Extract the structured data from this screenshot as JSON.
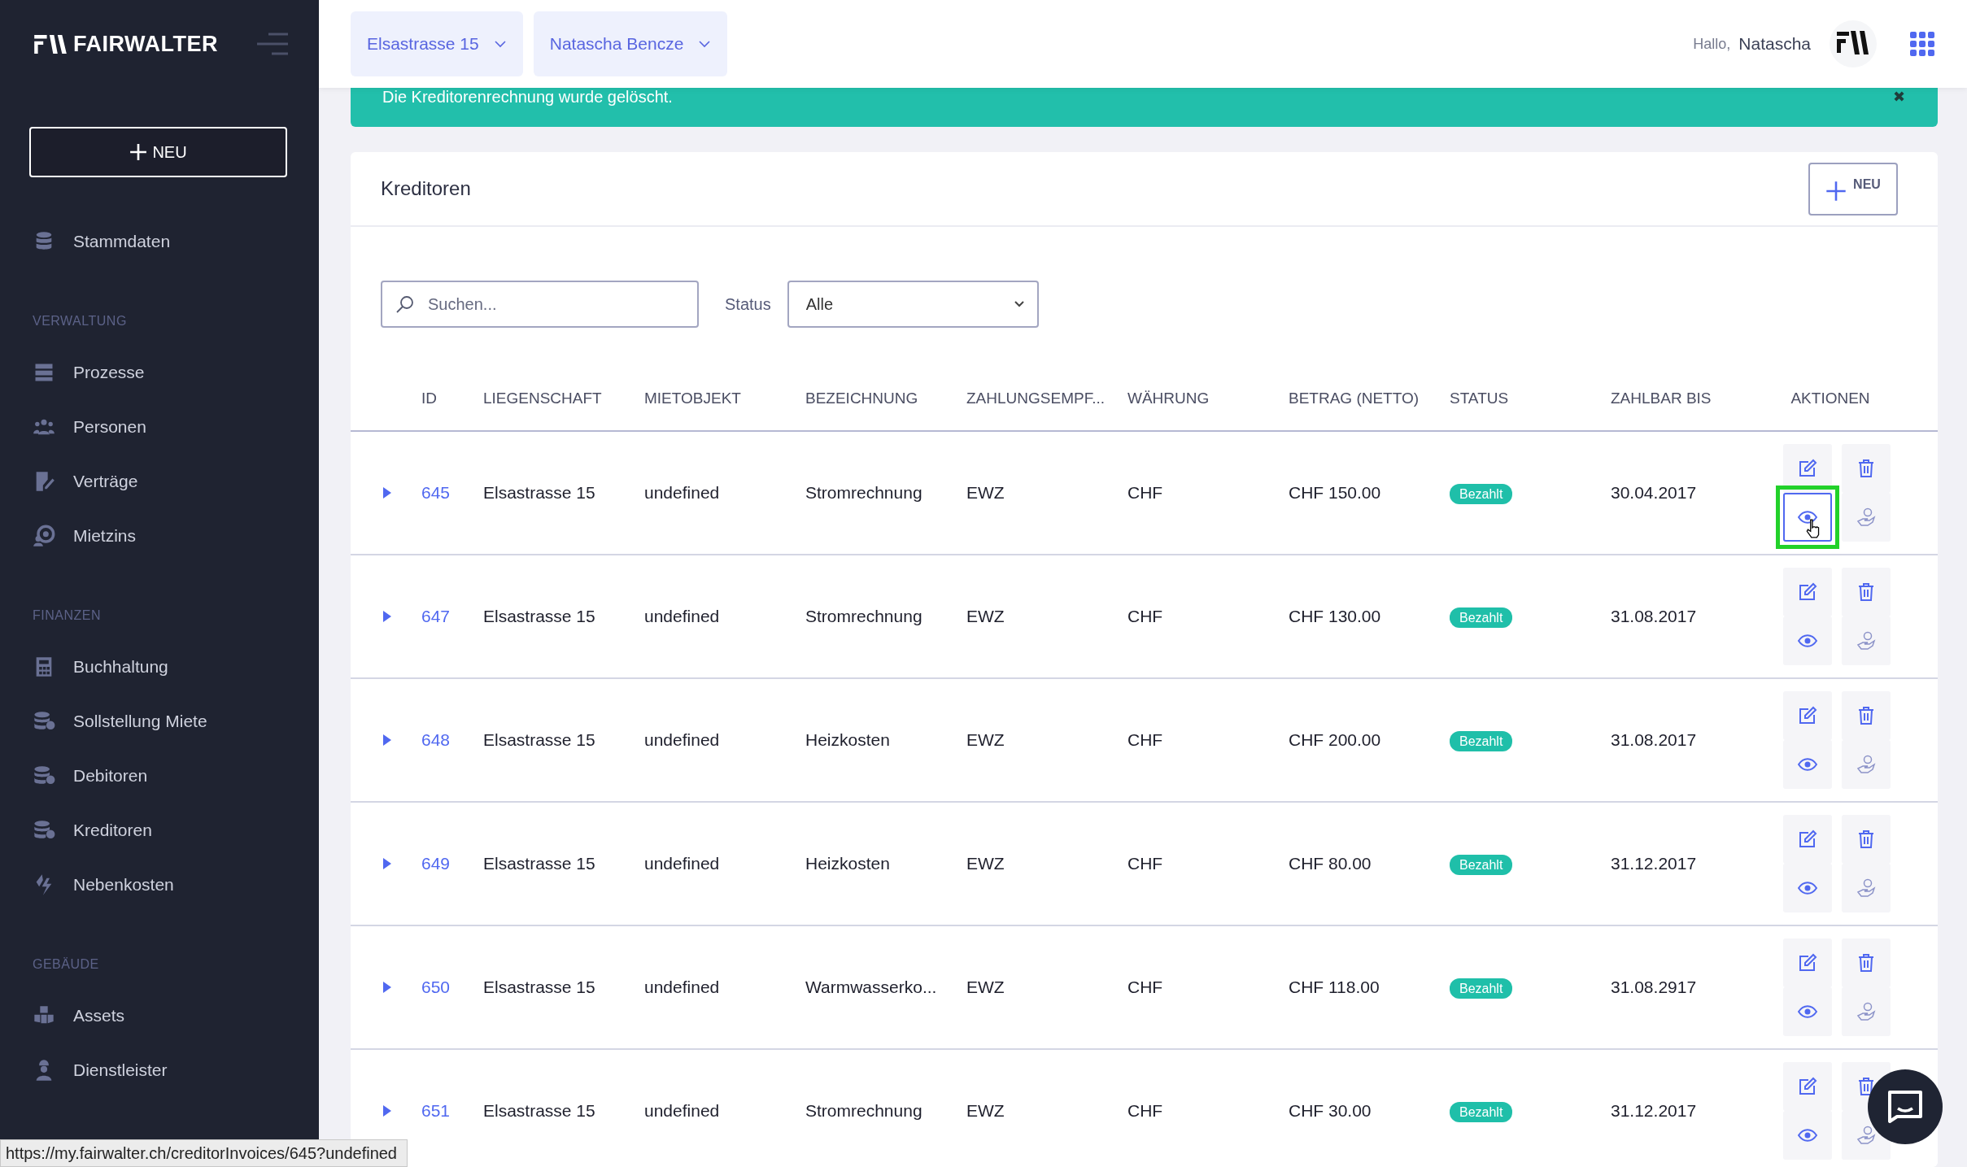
{
  "sidebar": {
    "logo": "FAIRWALTER",
    "new_button": "NEU",
    "top_items": [
      {
        "label": "Stammdaten",
        "selected": false
      }
    ],
    "sections": [
      {
        "title": "VERWALTUNG",
        "items": [
          {
            "label": "Prozesse",
            "selected": false
          },
          {
            "label": "Personen",
            "selected": false
          },
          {
            "label": "Verträge",
            "selected": false
          },
          {
            "label": "Mietzins",
            "selected": false
          }
        ]
      },
      {
        "title": "FINANZEN",
        "items": [
          {
            "label": "Buchhaltung",
            "selected": false
          },
          {
            "label": "Sollstellung Miete",
            "selected": false
          },
          {
            "label": "Debitoren",
            "selected": false
          },
          {
            "label": "Kreditoren",
            "selected": false
          },
          {
            "label": "Nebenkosten",
            "selected": false
          }
        ]
      },
      {
        "title": "GEBÄUDE",
        "items": [
          {
            "label": "Assets",
            "selected": false
          },
          {
            "label": "Dienstleister",
            "selected": false
          }
        ]
      }
    ]
  },
  "header": {
    "selectors": [
      "Elsastrasse 15",
      "Natascha Bencze"
    ],
    "greeting": "Hallo,",
    "user": "Natascha"
  },
  "notification": {
    "message": "Die Kreditorenrechnung wurde gelöscht.",
    "close": "✖"
  },
  "card": {
    "title": "Kreditoren",
    "new_button": "NEU",
    "search": {
      "placeholder": "Suchen..."
    },
    "status_label": "Status",
    "status_value": "Alle"
  },
  "table": {
    "columns": [
      "ID",
      "LIEGENSCHAFT",
      "MIETOBJEKT",
      "BEZEICHNUNG",
      "ZAHLUNGSEMPF...",
      "WÄHRUNG",
      "BETRAG (NETTO)",
      "STATUS",
      "ZAHLBAR BIS",
      "AKTIONEN"
    ],
    "rows": [
      {
        "id": "645",
        "property": "Elsastrasse 15",
        "unit": "undefined",
        "description": "Stromrechnung",
        "payee": "EWZ",
        "currency": "CHF",
        "amount": "CHF 150.00",
        "status": "Bezahlt",
        "due": "30.04.2017",
        "hovered": true
      },
      {
        "id": "647",
        "property": "Elsastrasse 15",
        "unit": "undefined",
        "description": "Stromrechnung",
        "payee": "EWZ",
        "currency": "CHF",
        "amount": "CHF 130.00",
        "status": "Bezahlt",
        "due": "31.08.2017",
        "hovered": false
      },
      {
        "id": "648",
        "property": "Elsastrasse 15",
        "unit": "undefined",
        "description": "Heizkosten",
        "payee": "EWZ",
        "currency": "CHF",
        "amount": "CHF 200.00",
        "status": "Bezahlt",
        "due": "31.08.2017",
        "hovered": false
      },
      {
        "id": "649",
        "property": "Elsastrasse 15",
        "unit": "undefined",
        "description": "Heizkosten",
        "payee": "EWZ",
        "currency": "CHF",
        "amount": "CHF 80.00",
        "status": "Bezahlt",
        "due": "31.12.2017",
        "hovered": false
      },
      {
        "id": "650",
        "property": "Elsastrasse 15",
        "unit": "undefined",
        "description": "Warmwasserko...",
        "payee": "EWZ",
        "currency": "CHF",
        "amount": "CHF 118.00",
        "status": "Bezahlt",
        "due": "31.08.2917",
        "hovered": false
      },
      {
        "id": "651",
        "property": "Elsastrasse 15",
        "unit": "undefined",
        "description": "Stromrechnung",
        "payee": "EWZ",
        "currency": "CHF",
        "amount": "CHF 30.00",
        "status": "Bezahlt",
        "due": "31.12.2017",
        "hovered": false
      }
    ]
  },
  "status_bar": "https://my.fairwalter.ch/creditorInvoices/645?undefined"
}
